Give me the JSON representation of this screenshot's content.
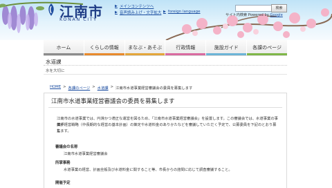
{
  "header": {
    "city_name": "江南市",
    "city_name_en": "KONAN CITY",
    "links": {
      "skip": "メインコンテンツへ",
      "reading": "音声読み上げ・文字拡大",
      "language": "foreign language"
    },
    "search": {
      "placeholder": "",
      "button_label": "検索",
      "note_prefix": "サイト内検索 Powered by",
      "note_google": "Google"
    }
  },
  "nav": {
    "items": [
      {
        "label": "ホーム",
        "color": "#8c8c8c"
      },
      {
        "label": "くらしの情報",
        "color": "#e88a2c"
      },
      {
        "label": "まなぶ・あそぶ",
        "color": "#e3a63a"
      },
      {
        "label": "行政情報",
        "color": "#d96aa0"
      },
      {
        "label": "施設ガイド",
        "color": "#6cb4d6"
      },
      {
        "label": "各課のページ",
        "color": "#7fb648"
      }
    ]
  },
  "dept": {
    "title": "水道課",
    "subtitle": "水を大切に"
  },
  "breadcrumb": {
    "home": "HOME",
    "sep": ">",
    "level1": "各課のページ",
    "level2": "水道課",
    "current": "江南市水道事業経営審議会の委員を募集します"
  },
  "article": {
    "title": "江南市水道事業経営審議会の委員を募集します",
    "intro_line1": "江南市の水道事業では、円滑かつ適正な運営を図るため、「江南市水道事業経営審議会」を設置します。この審議会では、水道事業の事業評",
    "intro_line2": "価や経営戦略（中長期的な経営の基本計画）の策定や水道料金のありかたなどを審議していただく予定で、公募委員を下記のとおり募集",
    "intro_line3": "します。",
    "sections": [
      {
        "heading": "審議会の名称",
        "body": "江南市水道事業経営審議会"
      },
      {
        "heading": "所掌事務",
        "body": "水道事業の経営、計画全般及び水道料金に関すること等、市長からの諮問に応じて調査審議すること。"
      },
      {
        "heading": "開催予定",
        "body": ""
      }
    ]
  }
}
